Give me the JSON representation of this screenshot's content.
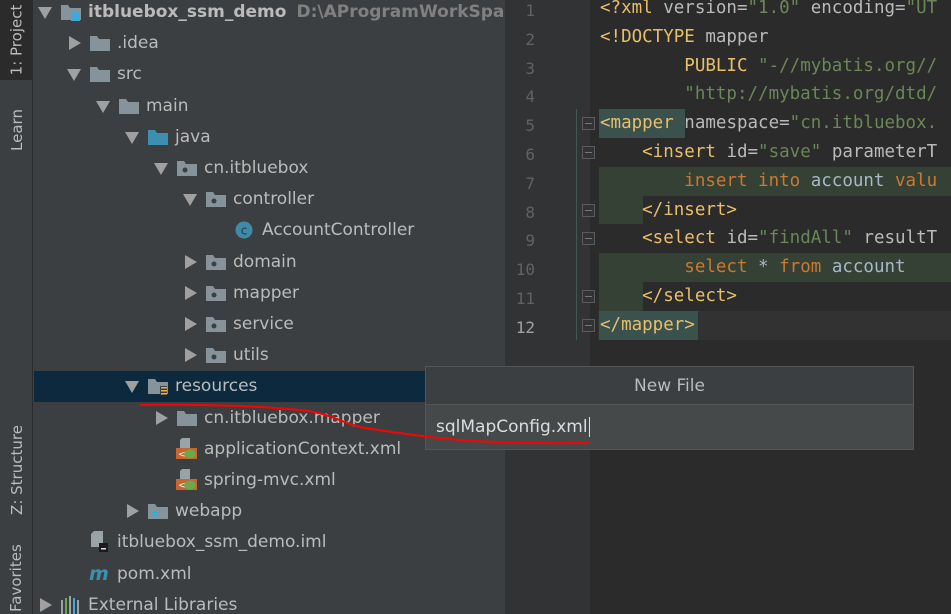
{
  "tool_windows": {
    "project": "1: Project",
    "learn": "Learn",
    "structure": "Z: Structure",
    "favorites": "Favorites"
  },
  "tree": [
    {
      "label": "itbluebox_ssm_demo",
      "path": "D:\\AProgramWorkSpace\\ide",
      "level": 0,
      "arrow": "down",
      "icon": "module-folder-icon",
      "bold": true
    },
    {
      "label": ".idea",
      "level": 1,
      "arrow": "right",
      "icon": "folder-icon"
    },
    {
      "label": "src",
      "level": 1,
      "arrow": "down",
      "icon": "folder-icon"
    },
    {
      "label": "main",
      "level": 2,
      "arrow": "down",
      "icon": "folder-icon"
    },
    {
      "label": "java",
      "level": 3,
      "arrow": "down",
      "icon": "source-folder-icon"
    },
    {
      "label": "cn.itbluebox",
      "level": 4,
      "arrow": "down",
      "icon": "package-icon"
    },
    {
      "label": "controller",
      "level": 5,
      "arrow": "down",
      "icon": "package-icon"
    },
    {
      "label": "AccountController",
      "level": 6,
      "arrow": "",
      "icon": "class-icon"
    },
    {
      "label": "domain",
      "level": 5,
      "arrow": "right",
      "icon": "package-icon"
    },
    {
      "label": "mapper",
      "level": 5,
      "arrow": "right",
      "icon": "package-icon"
    },
    {
      "label": "service",
      "level": 5,
      "arrow": "right",
      "icon": "package-icon"
    },
    {
      "label": "utils",
      "level": 5,
      "arrow": "right",
      "icon": "package-icon"
    },
    {
      "label": "resources",
      "level": 3,
      "arrow": "down",
      "icon": "resources-folder-icon",
      "selected": true
    },
    {
      "label": "cn.itbluebox.mapper",
      "level": 4,
      "arrow": "right",
      "icon": "folder-icon"
    },
    {
      "label": "applicationContext.xml",
      "level": 4,
      "arrow": "",
      "icon": "spring-xml-icon"
    },
    {
      "label": "spring-mvc.xml",
      "level": 4,
      "arrow": "",
      "icon": "spring-xml-icon"
    },
    {
      "label": "webapp",
      "level": 3,
      "arrow": "right",
      "icon": "web-folder-icon"
    },
    {
      "label": "itbluebox_ssm_demo.iml",
      "level": 1,
      "arrow": "",
      "icon": "iml-file-icon"
    },
    {
      "label": "pom.xml",
      "level": 1,
      "arrow": "",
      "icon": "maven-icon"
    },
    {
      "label": "External Libraries",
      "level": 0,
      "arrow": "right",
      "icon": "libraries-icon"
    }
  ],
  "editor": {
    "current_line": 12,
    "lines": [
      [
        [
          "<?xml ",
          "t"
        ],
        [
          "version=",
          "a"
        ],
        [
          "\"1.0\" ",
          "v"
        ],
        [
          "encoding=",
          "a"
        ],
        [
          "\"UT",
          "v"
        ]
      ],
      [
        [
          "<!DOCTYPE ",
          "t"
        ],
        [
          "mapper",
          "a"
        ]
      ],
      [
        [
          "        PUBLIC ",
          "t"
        ],
        [
          "\"-//mybatis.org//",
          "v"
        ]
      ],
      [
        [
          "        \"http://mybatis.org/dtd/",
          "v"
        ]
      ],
      [
        [
          "<mapper ",
          "t"
        ],
        [
          "namespace=",
          "a"
        ],
        [
          "\"cn.itbluebox.",
          "v"
        ]
      ],
      [
        [
          "    <insert ",
          "t"
        ],
        [
          "id=",
          "a"
        ],
        [
          "\"save\" ",
          "v"
        ],
        [
          "parameterT",
          "a"
        ]
      ],
      [
        [
          "        insert into ",
          "k"
        ],
        [
          "account ",
          "d"
        ],
        [
          "valu",
          "k"
        ]
      ],
      [
        [
          "    </insert>",
          "t"
        ]
      ],
      [
        [
          "    <select ",
          "t"
        ],
        [
          "id=",
          "a"
        ],
        [
          "\"findAll\" ",
          "v"
        ],
        [
          "resultT",
          "a"
        ]
      ],
      [
        [
          "        select ",
          "k"
        ],
        [
          "* ",
          "d"
        ],
        [
          "from ",
          "k"
        ],
        [
          "account",
          "d"
        ]
      ],
      [
        [
          "    </select>",
          "t"
        ]
      ],
      [
        [
          "</mapper>",
          "t"
        ]
      ]
    ]
  },
  "new_file_dialog": {
    "title": "New File",
    "value": "sqlMapConfig.xml"
  },
  "colors": {
    "selection": "#0d293e",
    "annotation": "#ff0000",
    "tag": "#e8bf6a",
    "string": "#6a8759",
    "keyword": "#cc7832"
  }
}
